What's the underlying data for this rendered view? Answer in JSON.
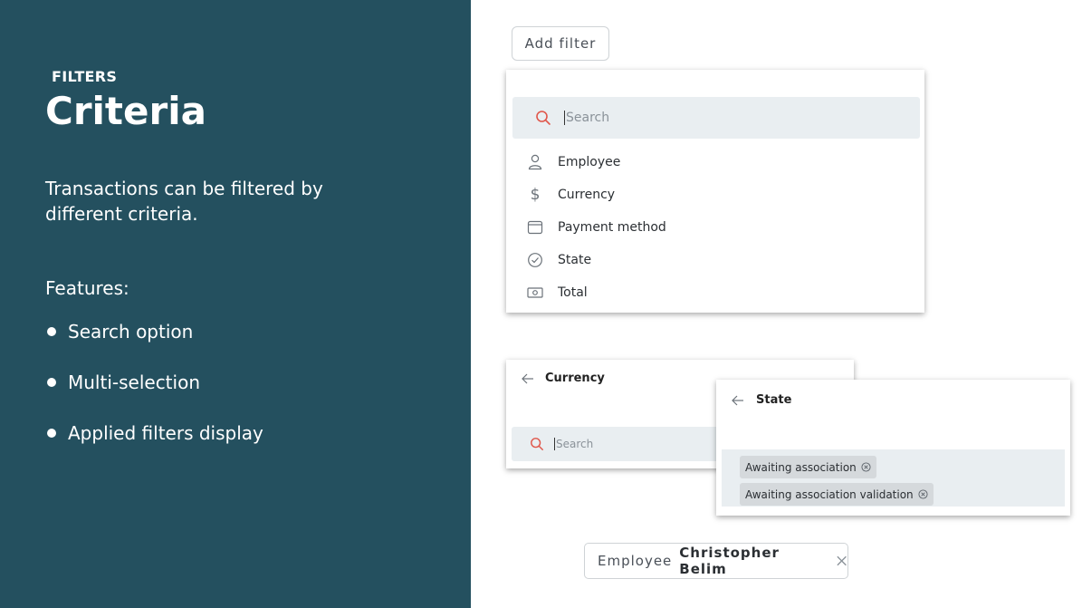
{
  "slide": {
    "eyebrow": "FILTERS",
    "title": "Criteria",
    "description": "Transactions can be filtered by different criteria.",
    "features_title": "Features:",
    "features": [
      "Search option",
      "Multi-selection",
      "Applied filters display"
    ]
  },
  "add_filter_button": "Add filter",
  "criteria_panel": {
    "search_placeholder": "Search",
    "items": [
      {
        "label": "Employee",
        "icon": "person-icon"
      },
      {
        "label": "Currency",
        "icon": "dollar-icon"
      },
      {
        "label": "Payment method",
        "icon": "wallet-icon"
      },
      {
        "label": "State",
        "icon": "check-circle-icon"
      },
      {
        "label": "Total",
        "icon": "cash-icon"
      }
    ]
  },
  "currency_panel": {
    "title": "Currency",
    "search_placeholder": "Search"
  },
  "state_panel": {
    "title": "State",
    "selected": [
      "Awaiting association",
      "Awaiting association validation"
    ]
  },
  "applied_chip": {
    "label": "Employee",
    "value": "Christopher Belim"
  },
  "colors": {
    "sidebar_bg": "#24505f",
    "search_bg": "#e9eef1",
    "search_icon": "#e0564a",
    "tag_bg": "#d5d9dc"
  }
}
